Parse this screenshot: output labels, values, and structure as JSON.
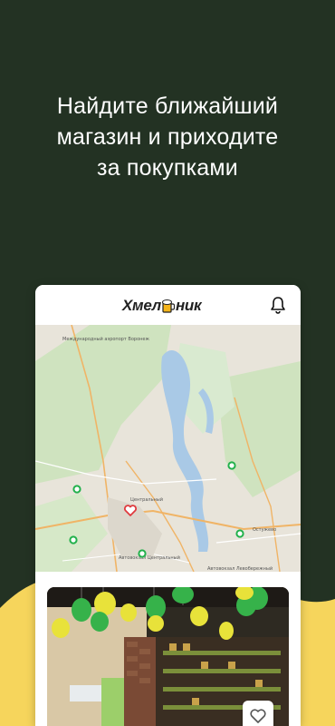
{
  "headline": {
    "line1": "Найдите ближайший",
    "line2": "магазин и приходите",
    "line3": "за покупками"
  },
  "app": {
    "logo_text_left": "Хмел",
    "logo_text_right": "ник"
  },
  "map": {
    "labels": {
      "airport": "Международный аэропорт Воронеж",
      "center": "Центральный",
      "bus_station": "Автовокзал Центральный",
      "bus_station2": "Автовокзал Левобережный",
      "district": "Остужево"
    }
  },
  "colors": {
    "background": "#233223",
    "accent_yellow": "#f6d55c",
    "store_marker": "#22b14c",
    "current_marker": "#e03a3e"
  }
}
